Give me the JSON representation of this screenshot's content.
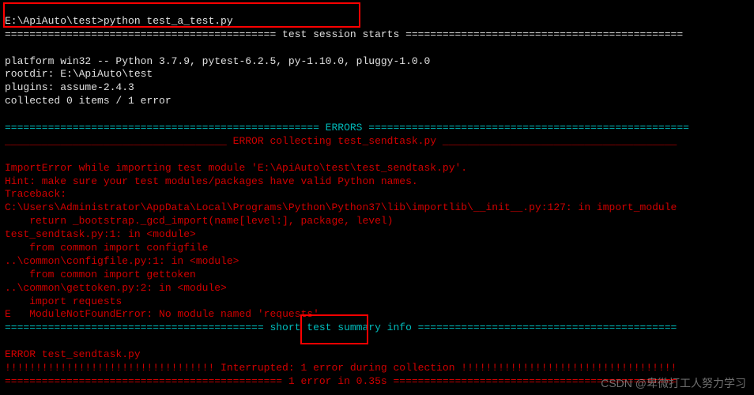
{
  "prompt_line": "E:\\ApiAuto\\test>python test_a_test.py",
  "session_header": "============================================ test session starts =============================================",
  "platform_line": "platform win32 -- Python 3.7.9, pytest-6.2.5, py-1.10.0, pluggy-1.0.0",
  "rootdir_line": "rootdir: E:\\ApiAuto\\test",
  "plugins_line": "plugins: assume-2.4.3",
  "collected_line": "collected 0 items / 1 error",
  "errors_header": "=================================================== ERRORS ====================================================",
  "error_collecting_line": "____________________________________ ERROR collecting test_sendtask.py ______________________________________",
  "import_error_line": "ImportError while importing test module 'E:\\ApiAuto\\test\\test_sendtask.py'.",
  "hint_line": "Hint: make sure your test modules/packages have valid Python names.",
  "traceback_label": "Traceback:",
  "trace1": "C:\\Users\\Administrator\\AppData\\Local\\Programs\\Python\\Python37\\lib\\importlib\\__init__.py:127: in import_module",
  "trace1_code": "    return _bootstrap._gcd_import(name[level:], package, level)",
  "trace2": "test_sendtask.py:1: in <module>",
  "trace2_code": "    from common import configfile",
  "trace3": "..\\common\\configfile.py:1: in <module>",
  "trace3_code": "    from common import gettoken",
  "trace4": "..\\common\\gettoken.py:2: in <module>",
  "trace4_code": "    import requests",
  "module_error_prefix": "E   ModuleNotFoundError: No module named ",
  "module_error_quoted": "'requests'",
  "summary_header": "========================================== short test summary info ==========================================",
  "error_file_line": "ERROR test_sendtask.py",
  "interrupted_line": "!!!!!!!!!!!!!!!!!!!!!!!!!!!!!!!!!! Interrupted: 1 error during collection !!!!!!!!!!!!!!!!!!!!!!!!!!!!!!!!!!!",
  "final_line": "============================================= 1 error in 0.35s ==============================================",
  "watermark": "CSDN @卑微打工人努力学习"
}
